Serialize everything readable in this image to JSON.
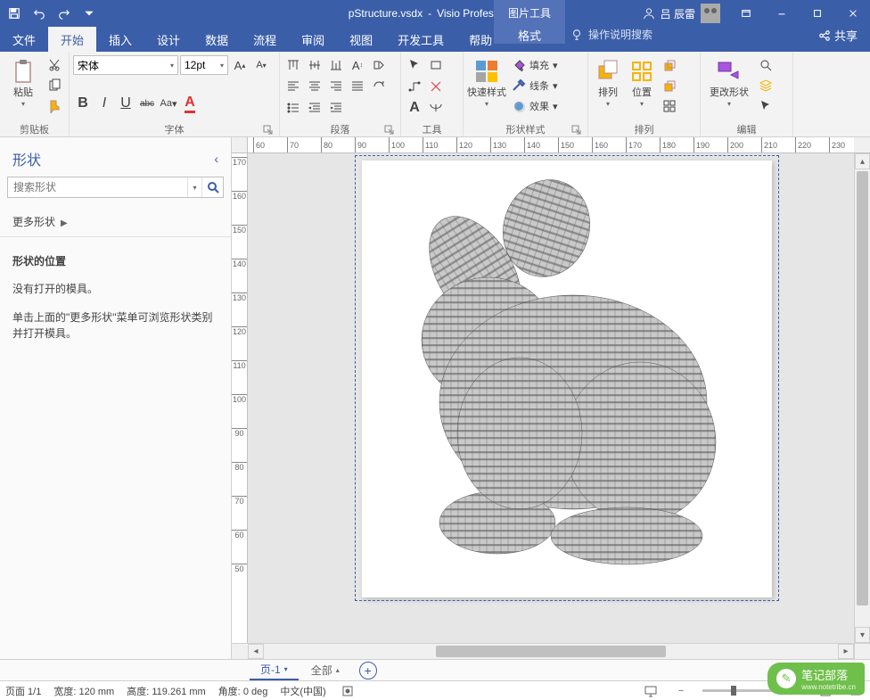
{
  "title": {
    "filename": "pStructure.vsdx",
    "app": "Visio Professional",
    "contextual_group": "图片工具"
  },
  "user": {
    "name": "吕 辰雷"
  },
  "tabs": {
    "file": "文件",
    "home": "开始",
    "insert": "插入",
    "design": "设计",
    "data": "数据",
    "process": "流程",
    "review": "审阅",
    "view": "视图",
    "developer": "开发工具",
    "help": "帮助",
    "format": "格式",
    "tell_me": "操作说明搜索",
    "share": "共享"
  },
  "ribbon": {
    "clipboard": {
      "label": "剪贴板",
      "paste": "粘贴"
    },
    "font": {
      "label": "字体",
      "family": "宋体",
      "size": "12pt",
      "bold": "B",
      "italic": "I",
      "underline": "U",
      "strike": "abc",
      "case": "Aa"
    },
    "paragraph": {
      "label": "段落"
    },
    "tools": {
      "label": "工具"
    },
    "shape_styles": {
      "label": "形状样式",
      "quick": "快速样式",
      "fill": "填充",
      "line": "线条",
      "effects": "效果"
    },
    "arrange": {
      "label": "排列",
      "align": "排列",
      "position": "位置"
    },
    "edit": {
      "label": "编辑",
      "change_shape": "更改形状"
    }
  },
  "shapes_pane": {
    "title": "形状",
    "search_placeholder": "搜索形状",
    "more_shapes": "更多形状",
    "position_title": "形状的位置",
    "no_stencil": "没有打开的模具。",
    "hint": "单击上面的\"更多形状\"菜单可浏览形状类别并打开模具。"
  },
  "ruler": {
    "h": [
      "60",
      "70",
      "80",
      "90",
      "100",
      "110",
      "120",
      "130",
      "140",
      "150",
      "160",
      "170",
      "180",
      "190",
      "200",
      "210",
      "220",
      "230"
    ],
    "v": [
      "170",
      "160",
      "150",
      "140",
      "130",
      "120",
      "110",
      "100",
      "90",
      "80",
      "70",
      "60",
      "50"
    ]
  },
  "page_tabs": {
    "page1": "页-1",
    "scope": "全部"
  },
  "status": {
    "page": "页面 1/1",
    "width_label": "宽度:",
    "width_val": "120 mm",
    "height_label": "高度:",
    "height_val": "119.261 mm",
    "angle_label": "角度:",
    "angle_val": "0 deg",
    "lang": "中文(中国)"
  },
  "watermark": {
    "text": "笔记部落",
    "sub": "www.notetribe.cn"
  }
}
